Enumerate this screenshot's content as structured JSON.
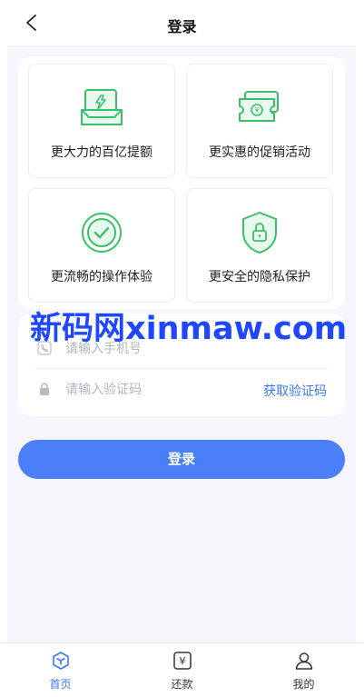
{
  "header": {
    "title": "登录",
    "back_icon": "chevron-left-icon"
  },
  "features": [
    {
      "label": "更大力的百亿提额",
      "icon": "money-up-icon"
    },
    {
      "label": "更实惠的促销活动",
      "icon": "coupon-icon"
    },
    {
      "label": "更流畅的操作体验",
      "icon": "check-circle-icon"
    },
    {
      "label": "更安全的隐私保护",
      "icon": "shield-lock-icon"
    }
  ],
  "watermark": "新码网xinmaw.com",
  "form": {
    "phone_placeholder": "请输入手机号",
    "code_placeholder": "请输入验证码",
    "get_code_label": "获取验证码"
  },
  "login_button": "登录",
  "tabbar": [
    {
      "label": "首页",
      "icon": "home-cube-icon",
      "active": true
    },
    {
      "label": "还款",
      "icon": "yen-receipt-icon",
      "active": false
    },
    {
      "label": "我的",
      "icon": "user-icon",
      "active": false
    }
  ],
  "colors": {
    "accent": "#4b7ff7",
    "icon_green": "#3cbf6a",
    "link": "#3b78f5",
    "background": "#f5f6fb"
  }
}
